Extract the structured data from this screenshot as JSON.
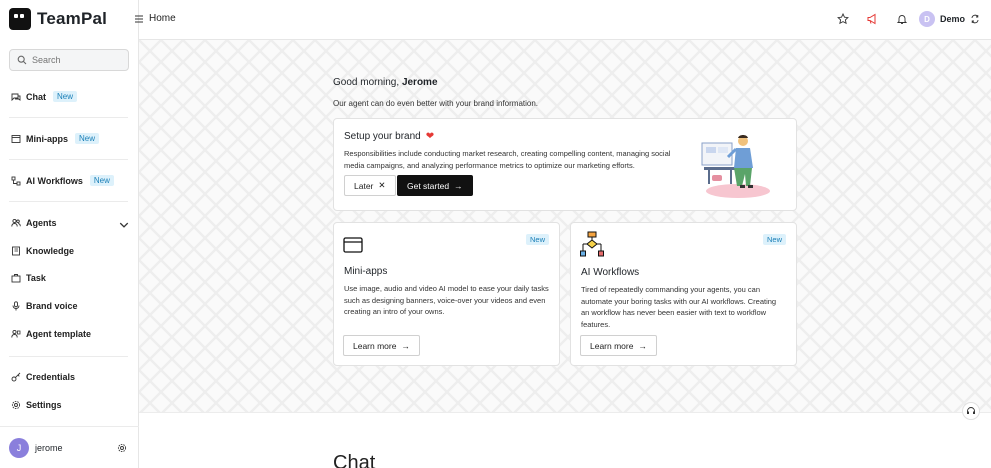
{
  "app": {
    "name": "TeamPal"
  },
  "sidebar": {
    "search_placeholder": "Search",
    "items": [
      {
        "label": "Chat",
        "badge": "New"
      },
      {
        "label": "Mini-apps",
        "badge": "New"
      },
      {
        "label": "AI Workflows",
        "badge": "New"
      },
      {
        "label": "Agents"
      },
      {
        "label": "Knowledge"
      },
      {
        "label": "Task"
      },
      {
        "label": "Brand voice"
      },
      {
        "label": "Agent template"
      },
      {
        "label": "Credentials"
      },
      {
        "label": "Settings"
      }
    ],
    "user": {
      "initial": "J",
      "name": "jerome"
    }
  },
  "header": {
    "title": "Home",
    "workspace": {
      "initial": "D",
      "name": "Demo"
    }
  },
  "main": {
    "greeting_prefix": "Good morning,",
    "greeting_name": "Jerome",
    "subtitle": "Our agent can do even better with your brand information.",
    "brand_card": {
      "title": "Setup your brand",
      "heart": "❤",
      "description": "Responsibilities include conducting market research, creating compelling content, managing social media campaigns, and analyzing performance metrics to optimize our marketing efforts.",
      "later_label": "Later",
      "later_icon": "✕",
      "start_label": "Get started",
      "start_icon": "→"
    },
    "features": [
      {
        "tag": "New",
        "title": "Mini-apps",
        "description": "Use image, audio and video AI model to ease your daily tasks such as designing banners, voice-over your videos and even creating an intro of your owns.",
        "button": "Learn more",
        "button_icon": "→"
      },
      {
        "tag": "New",
        "title": "AI Workflows",
        "description": "Tired of repeatedly commanding your agents, you can automate your boring tasks with our AI workflows. Creating an workflow has never been easier with text to workflow features.",
        "button": "Learn more",
        "button_icon": "→"
      }
    ],
    "chat_heading": "Chat"
  },
  "colors": {
    "accent_badge_bg": "#ddf1fb",
    "accent_badge_text": "#1a7fb7",
    "primary_button": "#111111",
    "heart": "#e53935",
    "avatar_user": "#8a7fdc"
  }
}
